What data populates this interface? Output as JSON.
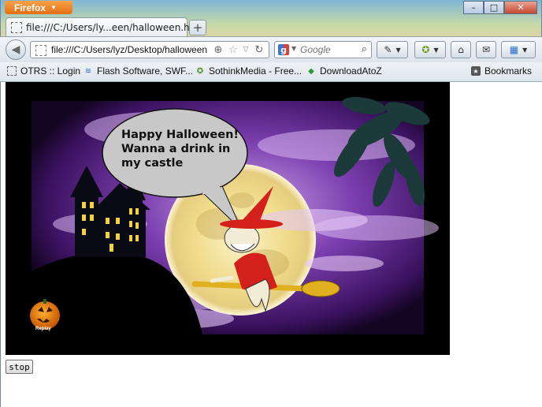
{
  "browser": {
    "app_button": "Firefox",
    "tab_title": "file:///C:/Users/ly...een/halloween.html",
    "new_tab": "+",
    "url": "file:///C:/Users/lyz/Desktop/halloween",
    "search_placeholder": "Google",
    "bookmarks_label": "Bookmarks",
    "bookmark_items": [
      {
        "label": "OTRS :: Login",
        "icon": "page-icon"
      },
      {
        "label": "Flash Software, SWF...",
        "icon": "flash-icon"
      },
      {
        "label": "SothinkMedia - Free...",
        "icon": "sothink-icon"
      },
      {
        "label": "DownloadAtoZ",
        "icon": "download-icon"
      }
    ]
  },
  "page": {
    "bubble_lines": [
      "Happy Halloween!",
      "Wanna a drink in",
      "my castle"
    ],
    "replay_label": "Replay",
    "stop_button": "stop"
  },
  "colors": {
    "moon": "#f2e6a8",
    "sky": "#5a2a8a",
    "hat": "#d4201a",
    "broom": "#e0b020",
    "bubble": "#c8c8c8"
  }
}
